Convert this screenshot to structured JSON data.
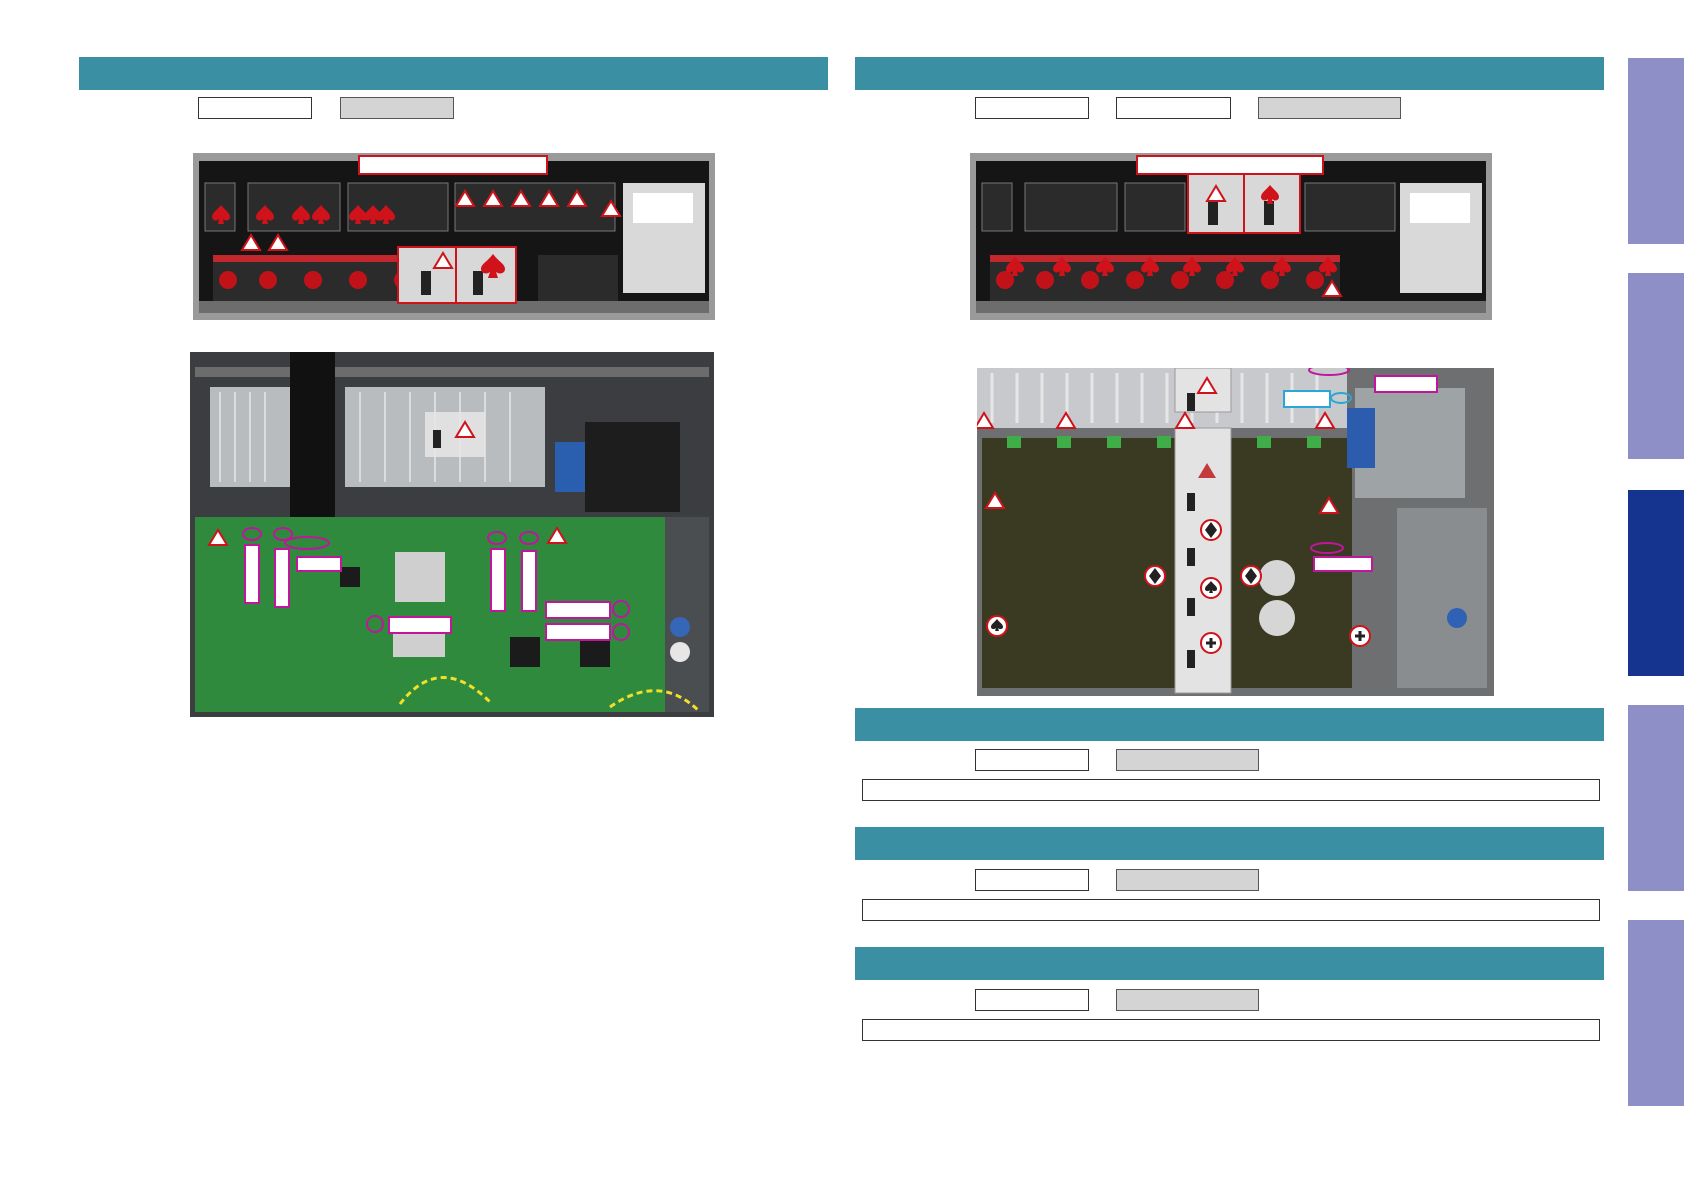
{
  "colors": {
    "section_bar": "#3a8fa3",
    "side_tab": "#8d8fc6",
    "side_tab_active": "#14348f",
    "marker_red": "#d0121b",
    "callout_magenta": "#c0169b",
    "callout_cyan": "#2aa7d6"
  },
  "side_tabs": [
    {
      "active": false
    },
    {
      "active": false
    },
    {
      "active": true
    },
    {
      "active": false
    },
    {
      "active": false
    }
  ],
  "marker_icons": [
    "triangle-marker-icon",
    "spade-marker-icon",
    "diamond-marker-icon",
    "circle-marker-icon",
    "plus-marker-icon",
    "screw-icon"
  ]
}
